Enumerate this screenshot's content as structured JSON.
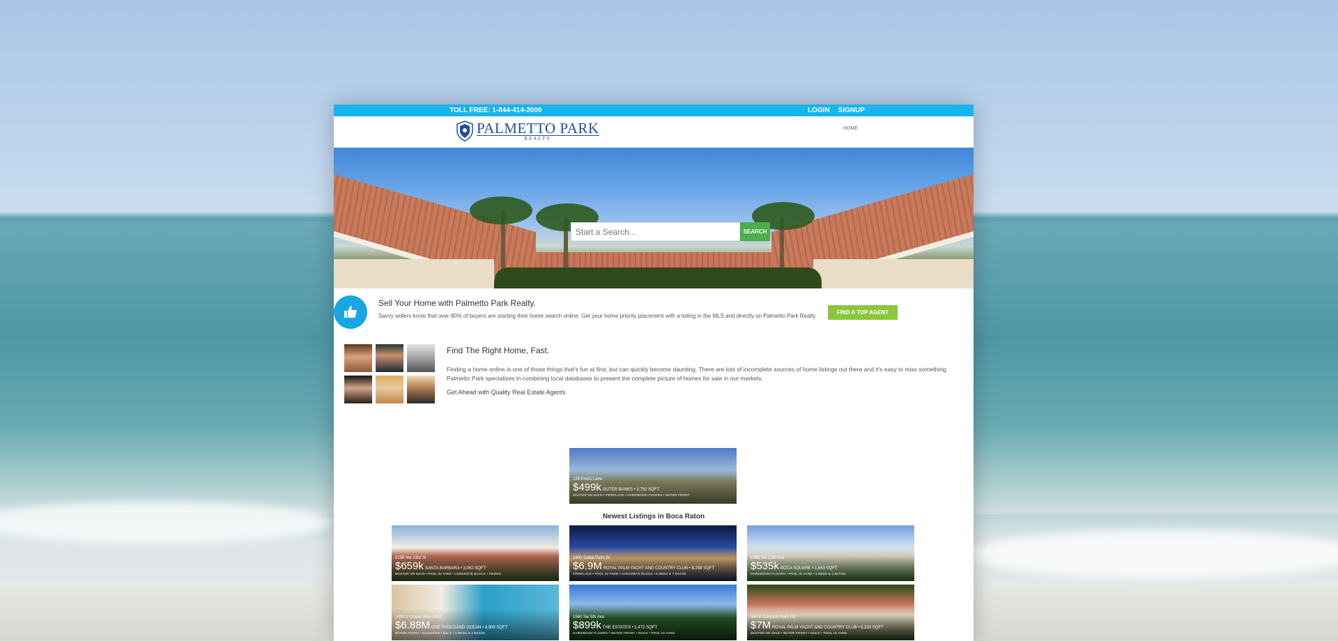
{
  "topbar": {
    "phone": "TOLL FREE: 1-844-414-2000",
    "login": "LOGIN",
    "signup": "SIGNUP"
  },
  "brand": {
    "name": "PALMETTO PARK",
    "tagline": "REALTY",
    "accent": "#18b4ee",
    "logo_color": "#1e4ea0"
  },
  "nav": {
    "home": "HOME"
  },
  "hero": {
    "search_placeholder": "Start a Search...",
    "search_button": "SEARCH"
  },
  "sell": {
    "title": "Sell Your Home with Palmetto Park Realty.",
    "text": "Savvy sellers know that over 90% of buyers are starting their home search online. Get your home priority placement with a listing in the MLS and directly on Palmetto Park Realty.",
    "button": "FIND A TOP AGENT",
    "icon": "thumbs-up-icon"
  },
  "find": {
    "title": "Find The Right Home, Fast.",
    "text": "Finding a home online is one of those things that's fun at first, but can quickly become daunting. There are lots of incomplete sources of home listings out there and it's easy to miss something. Palmetto Park specializes in combining local databases to present the complete picture of homes for sale in our markets.",
    "subtitle": "Get Ahead with Quality Real Estate Agents"
  },
  "featured": {
    "address": "129 Knots Lane",
    "price": "$499k",
    "details": "OUTER BANKS • 3,750 SQFT",
    "features": "MASTER ON MAIN • FIREPLACE • HARDWOOD FLOORS • WATER FRONT"
  },
  "newest": {
    "title": "Newest Listings in Boca Raton",
    "listings": [
      {
        "address": "6198 Nw 23rd St",
        "price": "$659k",
        "details": "SANTA BARBARA • 3,062 SQFT",
        "features": "MASTER ON MAIN • POOL IN YARD • CONCRETE BLOCK • TENNIS"
      },
      {
        "address": "1900 Sabal Palm Dr",
        "price": "$6.9M",
        "details": "ROYAL PALM YACHT AND COUNTRY CLUB • 8,258 SQFT",
        "features": "FIREPLACE • POOL IN YARD • CONCRETE BLOCK • 5 BEDS & 7 BATHS"
      },
      {
        "address": "1098 Sw 13th Ave",
        "price": "$535k",
        "details": "BOCA SQUARE • 1,643 SQFT",
        "features": "HARDWOOD FLOORS • POOL IN YARD • 4 BEDS & 2 BATHS"
      },
      {
        "address": "1000 S Ocean Blvd #301",
        "price": "$6.88M",
        "details": "ONE THOUSAND OCEAN • 4,908 SQFT",
        "features": "WATER FRONT • ELEVATOR • BALC • 4 BEDS & 4 BATHS"
      },
      {
        "address": "1560 Sw 5th Ave",
        "price": "$899k",
        "details": "THE ESTATES • 2,472 SQFT",
        "features": "HARDWOOD FLOORS • WATER FRONT • DOCK • POOL IN YARD"
      },
      {
        "address": "444 E Coconut Palm Rd",
        "price": "$7M",
        "details": "ROYAL PALM YACHT AND COUNTRY CLUB • 8,233 SQFT",
        "features": "MASTER ON MAIN • WATER FRONT • DOCK • POOL IN YARD"
      }
    ]
  }
}
